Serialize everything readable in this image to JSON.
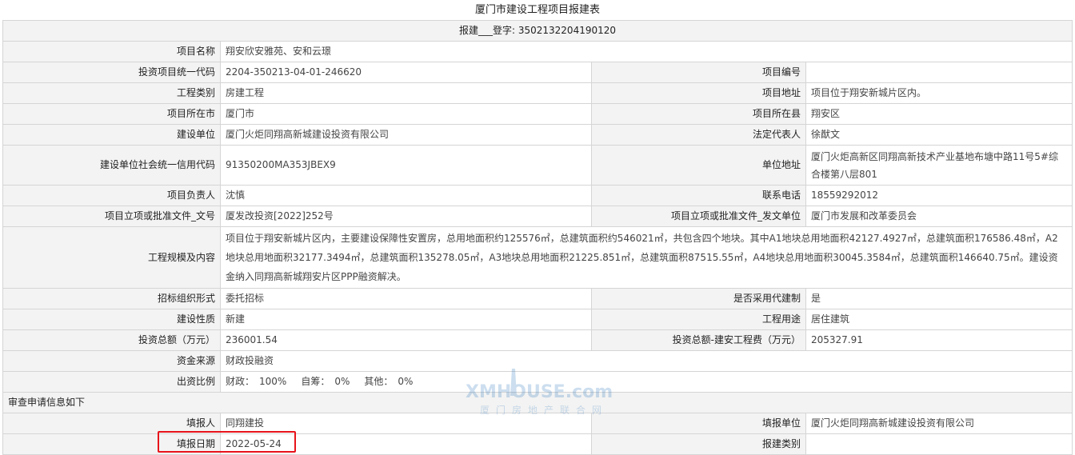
{
  "title": "厦门市建设工程项目报建表",
  "register_no": "报建___登字: 3502132204190120",
  "rows": {
    "project_name": {
      "label": "项目名称",
      "value": "翔安欣安雅苑、安和云璟"
    },
    "invest_code": {
      "label": "投资项目统一代码",
      "value": "2204-350213-04-01-246620"
    },
    "project_no": {
      "label": "项目编号",
      "value": ""
    },
    "category": {
      "label": "工程类别",
      "value": "房建工程"
    },
    "address": {
      "label": "项目地址",
      "value": "项目位于翔安新城片区内。"
    },
    "city": {
      "label": "项目所在市",
      "value": "厦门市"
    },
    "county": {
      "label": "项目所在县",
      "value": "翔安区"
    },
    "builder": {
      "label": "建设单位",
      "value": "厦门火炬同翔高新城建设投资有限公司"
    },
    "legal_rep": {
      "label": "法定代表人",
      "value": "徐猷文"
    },
    "credit_code": {
      "label": "建设单位社会统一信用代码",
      "value": "91350200MA353JBEX9"
    },
    "unit_address": {
      "label": "单位地址",
      "value": "厦门火炬高新区同翔高新技术产业基地布塘中路11号5#综合楼第八层801"
    },
    "leader": {
      "label": "项目负责人",
      "value": "沈慎"
    },
    "phone": {
      "label": "联系电话",
      "value": "18559292012"
    },
    "approval_doc": {
      "label": "项目立项或批准文件_文号",
      "value": "厦发改投资[2022]252号"
    },
    "approval_unit": {
      "label": "项目立项或批准文件_发文单位",
      "value": "厦门市发展和改革委员会"
    },
    "scale": {
      "label": "工程规模及内容",
      "value": "项目位于翔安新城片区内，主要建设保障性安置房，总用地面积约125576㎡，总建筑面积约546021㎡，共包含四个地块。其中A1地块总用地面积42127.4927㎡，总建筑面积176586.48㎡，A2地块总用地面积32177.3494㎡，总建筑面积135278.05㎡，A3地块总用地面积21225.851㎡，总建筑面积87515.55㎡，A4地块总用地面积30045.3584㎡，总建筑面积146640.75㎡。建设资金纳入同翔高新城翔安片区PPP融资解决。"
    },
    "bid_form": {
      "label": "招标组织形式",
      "value": "委托招标"
    },
    "agent_system": {
      "label": "是否采用代建制",
      "value": "是"
    },
    "nature": {
      "label": "建设性质",
      "value": "新建"
    },
    "usage": {
      "label": "工程用途",
      "value": "居住建筑"
    },
    "total_invest": {
      "label": "投资总额（万元）",
      "value": "236001.54"
    },
    "build_cost": {
      "label": "投资总额-建安工程费（万元）",
      "value": "205327.91"
    },
    "fund_source": {
      "label": "资金来源",
      "value": "财政投融资"
    },
    "ratio": {
      "label": "出资比例",
      "fiscal_label": "财政：",
      "fiscal_value": "100%",
      "self_label": "自筹：",
      "self_value": "0%",
      "other_label": "其他：",
      "other_value": "0%"
    },
    "review_section": "审查申请信息如下",
    "filler": {
      "label": "填报人",
      "value": "同翔建投"
    },
    "filler_unit": {
      "label": "填报单位",
      "value": "厦门火炬同翔高新城建设投资有限公司"
    },
    "fill_date": {
      "label": "填报日期",
      "value": "2022-05-24"
    },
    "report_type": {
      "label": "报建类别",
      "value": ""
    }
  },
  "watermark": {
    "brand": "XMHOUSE.com",
    "tagline": "厦门房地产联合网"
  }
}
